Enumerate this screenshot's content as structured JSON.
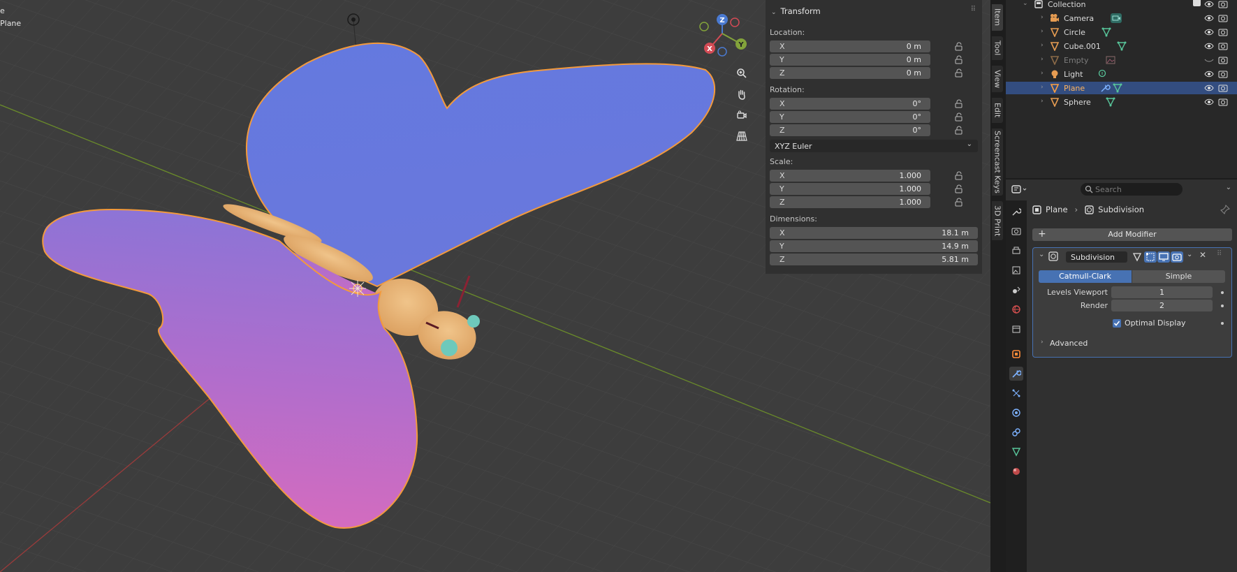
{
  "viewport": {
    "header_mode": "e",
    "header_object": "Plane",
    "axes": {
      "x": "X",
      "y": "Y",
      "z": "Z"
    }
  },
  "npanel": {
    "title": "Transform",
    "location_label": "Location:",
    "location": [
      {
        "axis": "X",
        "value": "0 m"
      },
      {
        "axis": "Y",
        "value": "0 m"
      },
      {
        "axis": "Z",
        "value": "0 m"
      }
    ],
    "rotation_label": "Rotation:",
    "rotation": [
      {
        "axis": "X",
        "value": "0°"
      },
      {
        "axis": "Y",
        "value": "0°"
      },
      {
        "axis": "Z",
        "value": "0°"
      }
    ],
    "rotation_mode": "XYZ Euler",
    "scale_label": "Scale:",
    "scale": [
      {
        "axis": "X",
        "value": "1.000"
      },
      {
        "axis": "Y",
        "value": "1.000"
      },
      {
        "axis": "Z",
        "value": "1.000"
      }
    ],
    "dimensions_label": "Dimensions:",
    "dimensions": [
      {
        "axis": "X",
        "value": "18.1 m"
      },
      {
        "axis": "Y",
        "value": "14.9 m"
      },
      {
        "axis": "Z",
        "value": "5.81 m"
      }
    ]
  },
  "side_tabs": [
    "Item",
    "Tool",
    "View",
    "Edit",
    "Screencast Keys",
    "3D Print"
  ],
  "outliner": {
    "collection": "Collection",
    "items": [
      {
        "name": "Camera",
        "type": "camera",
        "selected": false
      },
      {
        "name": "Circle",
        "type": "mesh",
        "selected": false
      },
      {
        "name": "Cube.001",
        "type": "mesh",
        "selected": false
      },
      {
        "name": "Empty",
        "type": "empty",
        "selected": false
      },
      {
        "name": "Light",
        "type": "light",
        "selected": false
      },
      {
        "name": "Plane",
        "type": "mesh",
        "selected": true
      },
      {
        "name": "Sphere",
        "type": "mesh",
        "selected": false
      }
    ]
  },
  "properties": {
    "search_placeholder": "Search",
    "breadcrumb_object": "Plane",
    "breadcrumb_modifier": "Subdivision",
    "add_modifier": "Add Modifier",
    "modifier": {
      "name": "Subdivision",
      "mode_catmull": "Catmull-Clark",
      "mode_simple": "Simple",
      "levels_viewport_label": "Levels Viewport",
      "levels_viewport": "1",
      "render_label": "Render",
      "render": "2",
      "optimal_display_label": "Optimal Display",
      "optimal_display": true,
      "advanced_label": "Advanced"
    }
  },
  "colors": {
    "accent": "#4772b3",
    "selection_orange": "#ffa040",
    "wing_blue": "#6078dd",
    "wing_pink": "#d46fc0",
    "body": "#e4a363"
  }
}
